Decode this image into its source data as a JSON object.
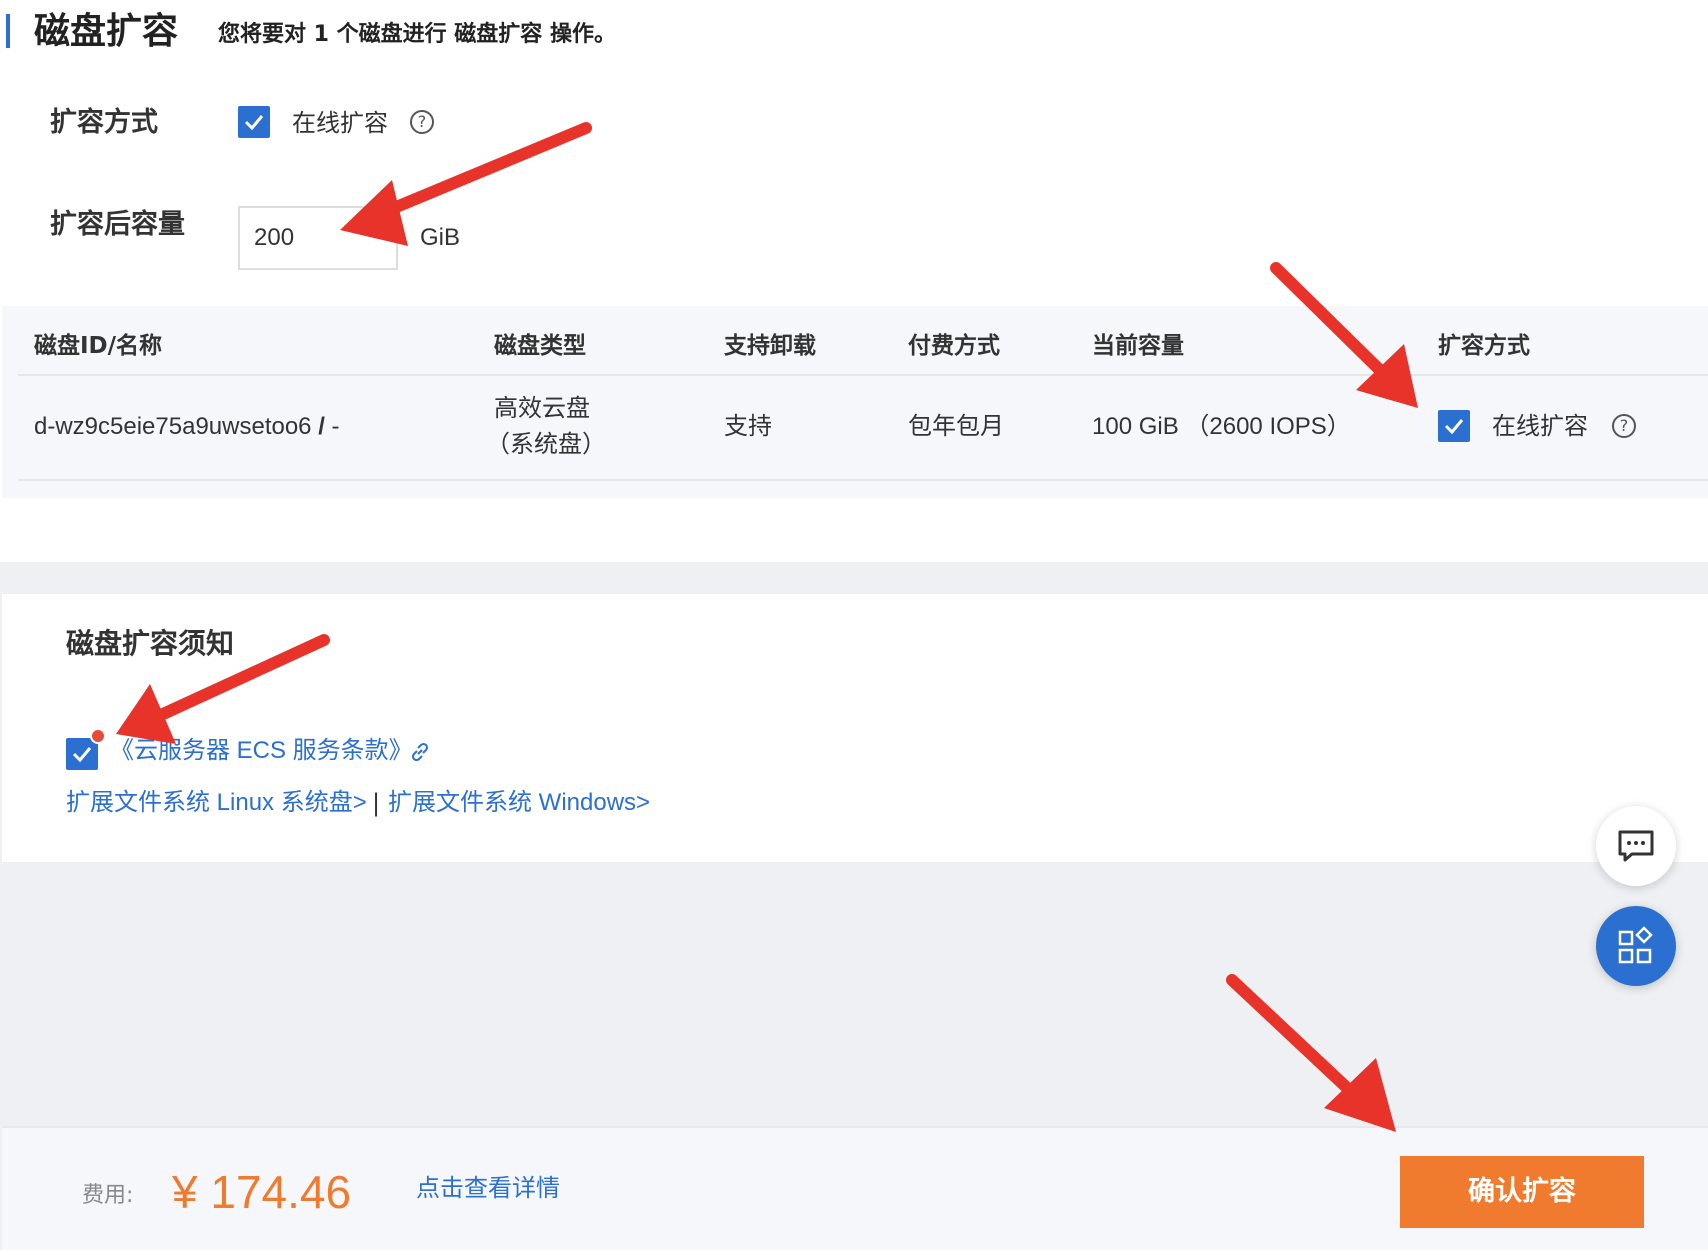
{
  "header": {
    "title": "磁盘扩容",
    "subtitle": "您将要对 1 个磁盘进行 磁盘扩容 操作。"
  },
  "form": {
    "method_label": "扩容方式",
    "method_option": "在线扩容",
    "method_checked": true,
    "capacity_label": "扩容后容量",
    "capacity_value": "200",
    "capacity_unit": "GiB"
  },
  "table": {
    "headers": [
      "磁盘ID/名称",
      "磁盘类型",
      "支持卸载",
      "付费方式",
      "当前容量",
      "扩容方式"
    ],
    "rows": [
      {
        "disk_id": "d-wz9c5eie75a9uwsetoo6",
        "disk_name_sep": "/",
        "disk_name": "-",
        "type_line1": "高效云盘",
        "type_line2": "（系统盘）",
        "detachable": "支持",
        "billing": "包年包月",
        "capacity": "100 GiB （2600 IOPS）",
        "method": "在线扩容",
        "method_checked": true
      }
    ]
  },
  "notice": {
    "title": "磁盘扩容须知",
    "terms_link": "《云服务器 ECS 服务条款》",
    "terms_checked": true,
    "linux_link": "扩展文件系统 Linux 系统盘>",
    "separator": "|",
    "windows_link": "扩展文件系统 Windows>"
  },
  "footer": {
    "fee_label": "费用:",
    "fee_amount": "¥ 174.46",
    "detail_link": "点击查看详情",
    "confirm_label": "确认扩容"
  },
  "help_glyph": "?",
  "icons": {
    "help": "question-circle-icon",
    "check": "checkmark-icon",
    "link": "link-icon",
    "chat": "chat-icon",
    "apps": "apps-icon"
  },
  "colors": {
    "accent": "#2b6fd1",
    "price": "#f07a2e",
    "confirm_button": "#f07a2e",
    "annotation_arrow": "#e8332a"
  }
}
